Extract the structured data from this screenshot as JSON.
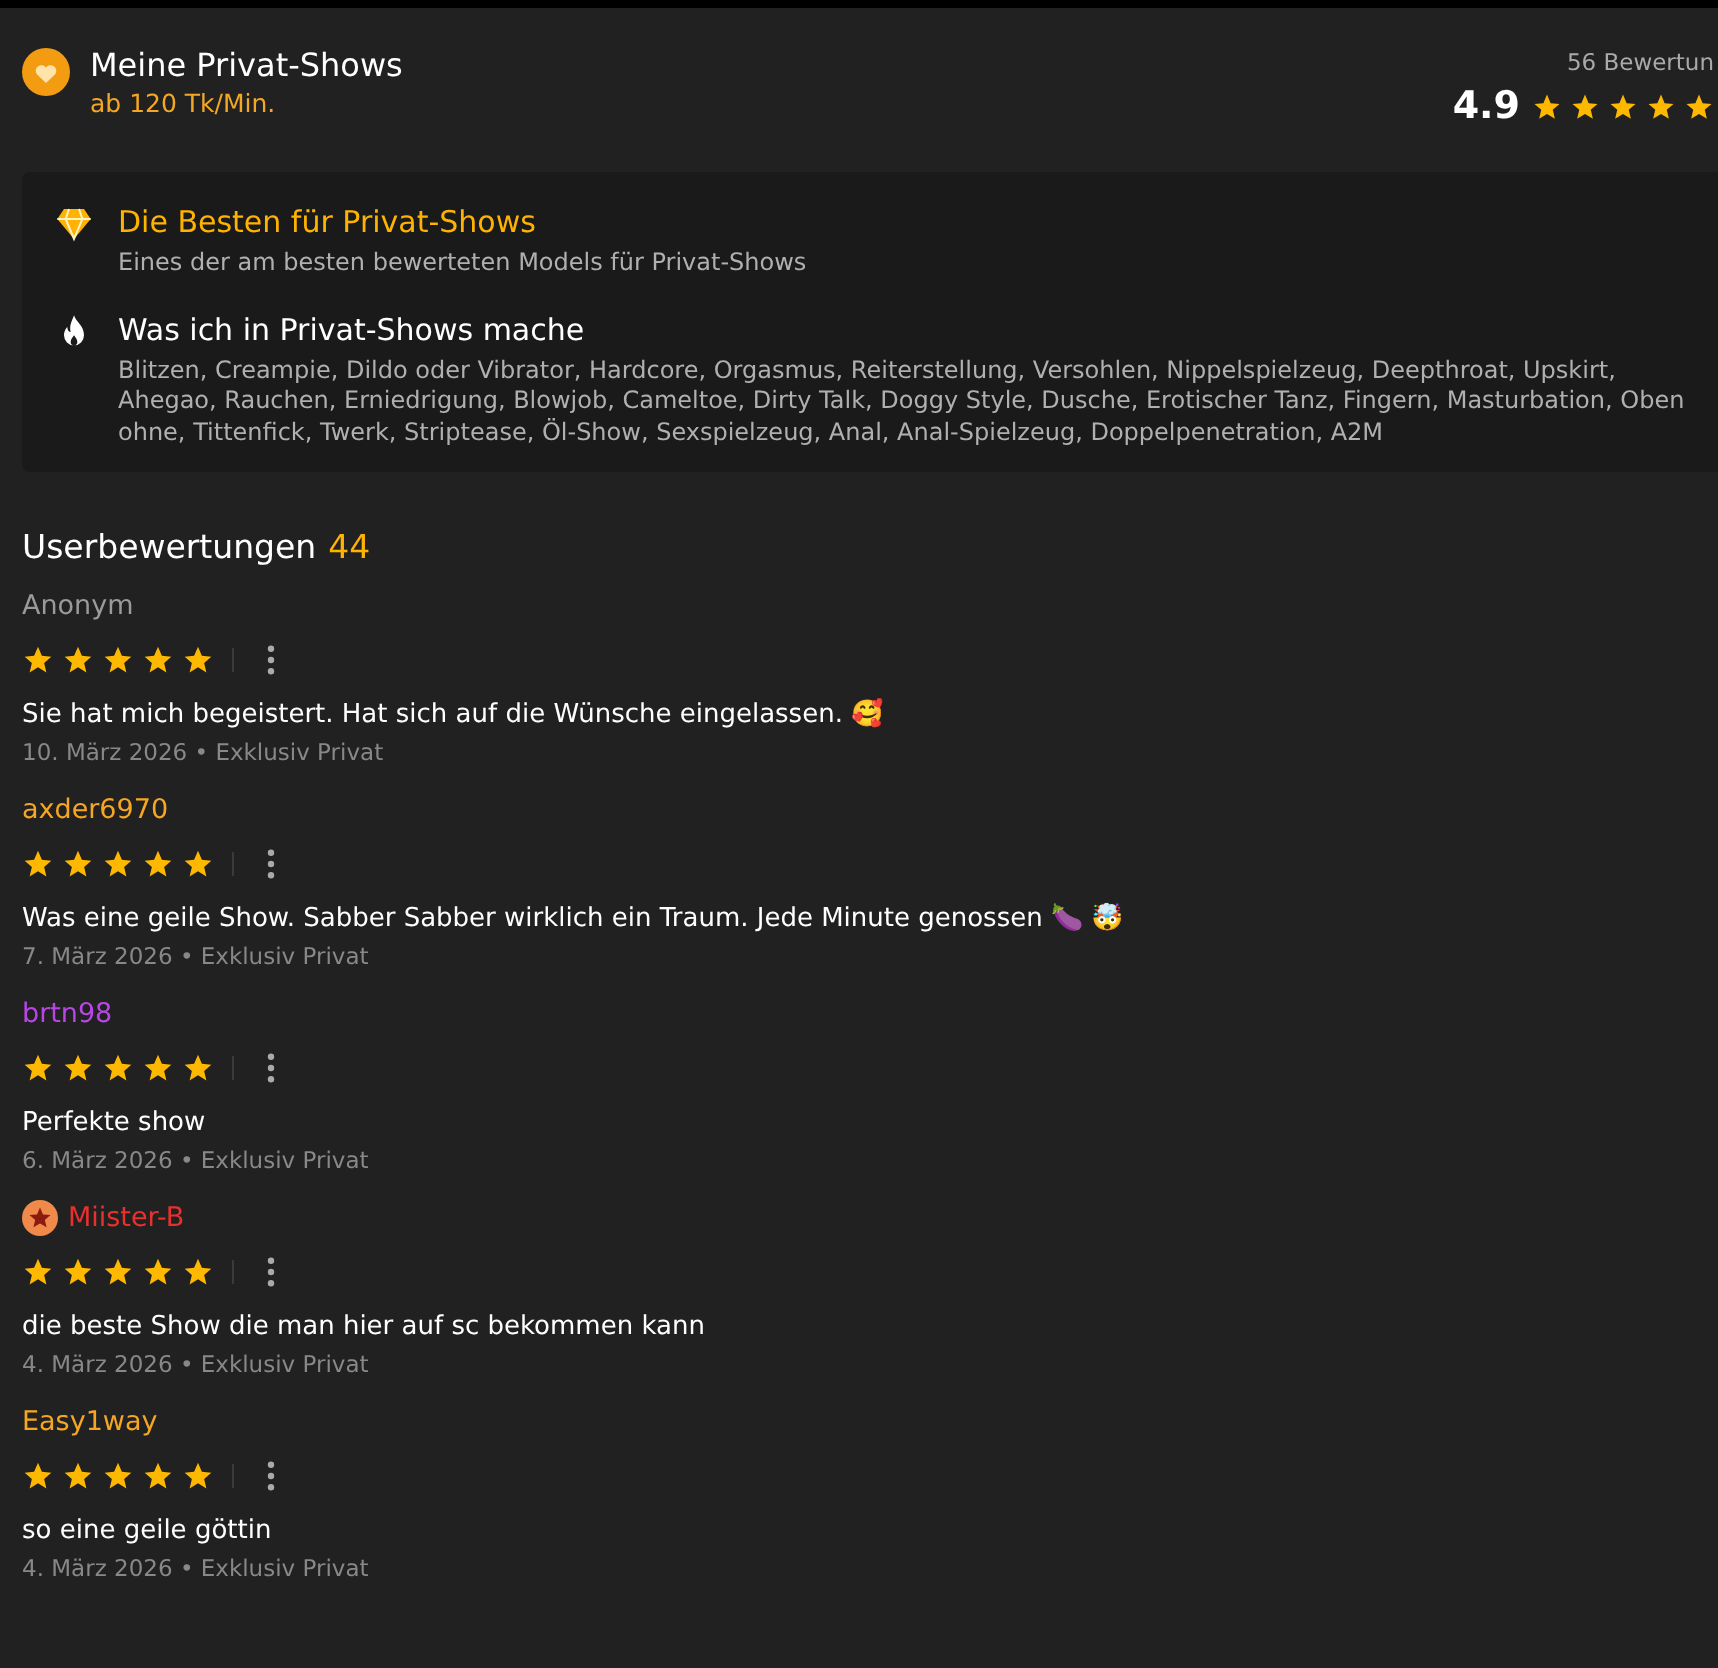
{
  "header": {
    "title": "Meine Privat-Shows",
    "price": "ab 120 Tk/Min.",
    "rating_count": "56 Bewertun",
    "rating": "4.9",
    "stars": 5
  },
  "features": [
    {
      "kind": "diamond",
      "title": "Die Besten für Privat-Shows",
      "text": "Eines der am besten bewerteten Models für Privat-Shows"
    },
    {
      "kind": "flame",
      "title": "Was ich in Privat-Shows mache",
      "text": "Blitzen, Creampie, Dildo oder Vibrator, Hardcore, Orgasmus, Reiterstellung, Versohlen, Nippelspielzeug, Deepthroat, Upskirt, Ahegao, Rauchen, Erniedrigung, Blowjob, Cameltoe, Dirty Talk, Doggy Style, Dusche, Erotischer Tanz, Fingern, Masturbation, Oben ohne, Tittenfick, Twerk, Striptease, Öl-Show, Sexspielzeug, Anal, Anal-Spielzeug, Doppelpenetration, A2M"
    }
  ],
  "reviews_heading": {
    "title": "Userbewertungen",
    "count": "44"
  },
  "reviews": [
    {
      "user": "Anonym",
      "color": "#9a9a9a",
      "badge": false,
      "stars": 5,
      "text": "Sie hat mich begeistert. Hat sich auf die Wünsche eingelassen. 🥰",
      "meta": "10. März 2026 • Exklusiv Privat"
    },
    {
      "user": "axder6970",
      "color": "#f5a623",
      "badge": false,
      "stars": 5,
      "text": "Was eine geile Show. Sabber Sabber wirklich ein Traum. Jede Minute genossen 🍆 🤯",
      "meta": "7. März 2026 • Exklusiv Privat"
    },
    {
      "user": "brtn98",
      "color": "#b846e6",
      "badge": false,
      "stars": 5,
      "text": "Perfekte show",
      "meta": "6. März 2026 • Exklusiv Privat"
    },
    {
      "user": "Miister-B",
      "color": "#e8302c",
      "badge": true,
      "stars": 5,
      "text": "die beste Show die man hier auf sc bekommen kann",
      "meta": "4. März 2026 • Exklusiv Privat"
    },
    {
      "user": "Easy1way",
      "color": "#f5a623",
      "badge": false,
      "stars": 5,
      "text": "so eine geile göttin",
      "meta": "4. März 2026 • Exklusiv Privat"
    }
  ]
}
